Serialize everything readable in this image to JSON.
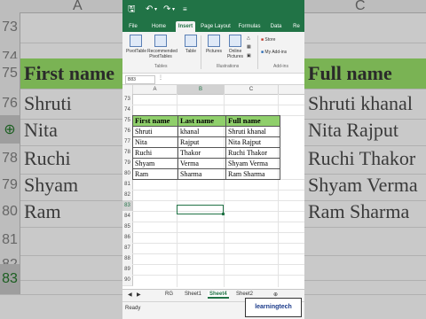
{
  "background": {
    "col_headers": [
      "A",
      "B",
      "C"
    ],
    "rows": [
      {
        "num": "73",
        "cells": [
          "",
          "",
          ""
        ]
      },
      {
        "num": "74",
        "cells": [
          "",
          "",
          ""
        ]
      },
      {
        "num": "75",
        "cells": [
          "First name",
          "Last name",
          "Full name"
        ],
        "header": true
      },
      {
        "num": "76",
        "cells": [
          "Shruti",
          "khanal",
          "Shruti khanal"
        ]
      },
      {
        "num": "77",
        "cells": [
          "Nita",
          "Rajput",
          "Nita Rajput"
        ]
      },
      {
        "num": "78",
        "cells": [
          "Ruchi",
          "Thakor",
          "Ruchi Thakor"
        ]
      },
      {
        "num": "79",
        "cells": [
          "Shyam",
          "Verma",
          "Shyam Verma"
        ]
      },
      {
        "num": "80",
        "cells": [
          "Ram",
          "Sharma",
          "Ram Sharma"
        ]
      },
      {
        "num": "81",
        "cells": [
          "",
          "",
          ""
        ]
      },
      {
        "num": "82",
        "cells": [
          "",
          "",
          ""
        ]
      },
      {
        "num": "83",
        "cells": [
          "",
          "",
          ""
        ]
      }
    ]
  },
  "titlebar": {
    "save_icon": "save-icon",
    "undo_icon": "undo-icon",
    "redo_icon": "redo-icon",
    "more_icon": "more-icon"
  },
  "tabs": [
    "File",
    "Home",
    "Insert",
    "Page Layout",
    "Formulas",
    "Data",
    "Re"
  ],
  "active_tab": "Insert",
  "ribbon": {
    "buttons": {
      "pivottable": "PivotTable",
      "recommended": "Recommended PivotTables",
      "table": "Table",
      "pictures": "Pictures",
      "online_pictures": "Online Pictures",
      "store": "Store",
      "my_addins": "My Add-ins"
    },
    "groups": {
      "tables": "Tables",
      "illustrations": "Illustrations",
      "addins": "Add-ins"
    }
  },
  "formula_bar": {
    "name_box": "B83"
  },
  "grid": {
    "columns": [
      "A",
      "B",
      "C"
    ],
    "rows": [
      "73",
      "74",
      "75",
      "76",
      "77",
      "78",
      "79",
      "80",
      "81",
      "82",
      "83",
      "84",
      "85",
      "86",
      "87",
      "88",
      "89",
      "90"
    ],
    "table_header": [
      "First name",
      "Last name",
      "Full name"
    ],
    "table_rows": [
      [
        "Shruti",
        "khanal",
        "Shruti khanal"
      ],
      [
        "Nita",
        "Rajput",
        "Nita Rajput"
      ],
      [
        "Ruchi",
        "Thakor",
        "Ruchi Thakor"
      ],
      [
        "Shyam",
        "Verma",
        "Shyam Verma"
      ],
      [
        "Ram",
        "Sharma",
        "Ram Sharma"
      ]
    ]
  },
  "sheets": [
    "RG",
    "Sheet1",
    "Sheet4",
    "Sheet2"
  ],
  "active_sheet": "Sheet4",
  "status": "Ready",
  "watermark": "learningtech",
  "colors": {
    "excel_green": "#217346",
    "header_green": "#8fcf6b"
  }
}
